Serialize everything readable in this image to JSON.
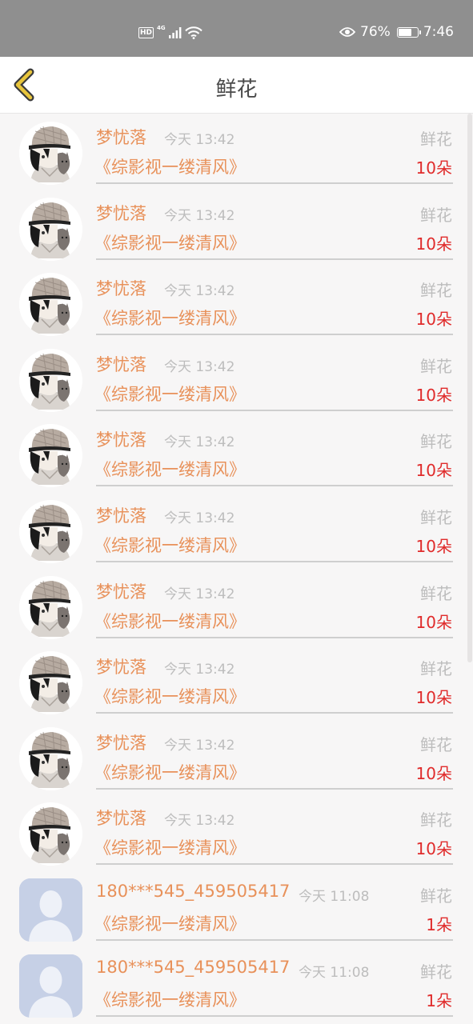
{
  "status_bar": {
    "hd": "HD",
    "network": "4G",
    "battery_percent": "76%",
    "battery_level": 0.76,
    "time": "7:46",
    "icons": [
      "signal-icon",
      "wifi-icon",
      "eye-icon",
      "battery-icon"
    ]
  },
  "nav": {
    "title": "鲜花",
    "back_icon": "chevron-left-icon"
  },
  "colors": {
    "accent_orange": "#e8915a",
    "quantity_red": "#e02b2b",
    "muted_gray": "#bdbdbd",
    "back_icon_yellow": "#e8c53c"
  },
  "records": [
    {
      "user": "梦忧落",
      "time": "今天 13:42",
      "type": "鲜花",
      "book": "《综影视一缕清风》",
      "qty": "10朵",
      "avatar": "anime-avatar"
    },
    {
      "user": "梦忧落",
      "time": "今天 13:42",
      "type": "鲜花",
      "book": "《综影视一缕清风》",
      "qty": "10朵",
      "avatar": "anime-avatar"
    },
    {
      "user": "梦忧落",
      "time": "今天 13:42",
      "type": "鲜花",
      "book": "《综影视一缕清风》",
      "qty": "10朵",
      "avatar": "anime-avatar"
    },
    {
      "user": "梦忧落",
      "time": "今天 13:42",
      "type": "鲜花",
      "book": "《综影视一缕清风》",
      "qty": "10朵",
      "avatar": "anime-avatar"
    },
    {
      "user": "梦忧落",
      "time": "今天 13:42",
      "type": "鲜花",
      "book": "《综影视一缕清风》",
      "qty": "10朵",
      "avatar": "anime-avatar"
    },
    {
      "user": "梦忧落",
      "time": "今天 13:42",
      "type": "鲜花",
      "book": "《综影视一缕清风》",
      "qty": "10朵",
      "avatar": "anime-avatar"
    },
    {
      "user": "梦忧落",
      "time": "今天 13:42",
      "type": "鲜花",
      "book": "《综影视一缕清风》",
      "qty": "10朵",
      "avatar": "anime-avatar"
    },
    {
      "user": "梦忧落",
      "time": "今天 13:42",
      "type": "鲜花",
      "book": "《综影视一缕清风》",
      "qty": "10朵",
      "avatar": "anime-avatar"
    },
    {
      "user": "梦忧落",
      "time": "今天 13:42",
      "type": "鲜花",
      "book": "《综影视一缕清风》",
      "qty": "10朵",
      "avatar": "anime-avatar"
    },
    {
      "user": "梦忧落",
      "time": "今天 13:42",
      "type": "鲜花",
      "book": "《综影视一缕清风》",
      "qty": "10朵",
      "avatar": "anime-avatar"
    },
    {
      "user": "180***545_459505417",
      "time": "今天 11:08",
      "type": "鲜花",
      "book": "《综影视一缕清风》",
      "qty": "1朵",
      "avatar": "default-avatar"
    },
    {
      "user": "180***545_459505417",
      "time": "今天 11:08",
      "type": "鲜花",
      "book": "《综影视一缕清风》",
      "qty": "1朵",
      "avatar": "default-avatar"
    }
  ]
}
